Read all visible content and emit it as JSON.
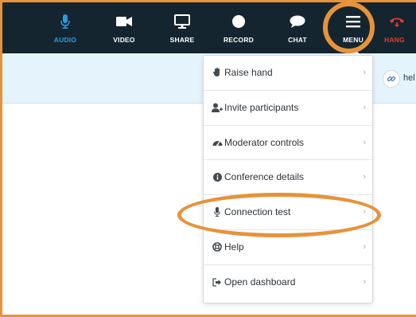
{
  "toolbar": {
    "buttons": [
      {
        "label": "AUDIO",
        "icon": "microphone-icon",
        "state": "active"
      },
      {
        "label": "VIDEO",
        "icon": "video-camera-icon"
      },
      {
        "label": "SHARE",
        "icon": "monitor-icon"
      },
      {
        "label": "RECORD",
        "icon": "record-icon"
      },
      {
        "label": "CHAT",
        "icon": "chat-bubble-icon"
      },
      {
        "label": "MENU",
        "icon": "hamburger-icon",
        "state": "open"
      },
      {
        "label": "HANG",
        "icon": "phone-hangup-icon"
      }
    ]
  },
  "notice": {
    "text": "hel",
    "icon": "link-icon"
  },
  "menu": {
    "items": [
      {
        "label": "Raise hand",
        "icon": "hand-icon"
      },
      {
        "label": "Invite participants",
        "icon": "add-user-icon"
      },
      {
        "label": "Moderator controls",
        "icon": "dashboard-gauge-icon"
      },
      {
        "label": "Conference details",
        "icon": "info-icon"
      },
      {
        "label": "Connection test",
        "icon": "microphone-icon"
      },
      {
        "label": "Help",
        "icon": "lifebuoy-icon"
      },
      {
        "label": "Open dashboard",
        "icon": "sign-out-icon"
      }
    ]
  },
  "colors": {
    "toolbar_bg": "#14252f",
    "active_blue": "#2a9be0",
    "hangup_red": "#e23c32",
    "notice_bg": "#e5f4fc",
    "highlight_orange": "#e8923a"
  }
}
